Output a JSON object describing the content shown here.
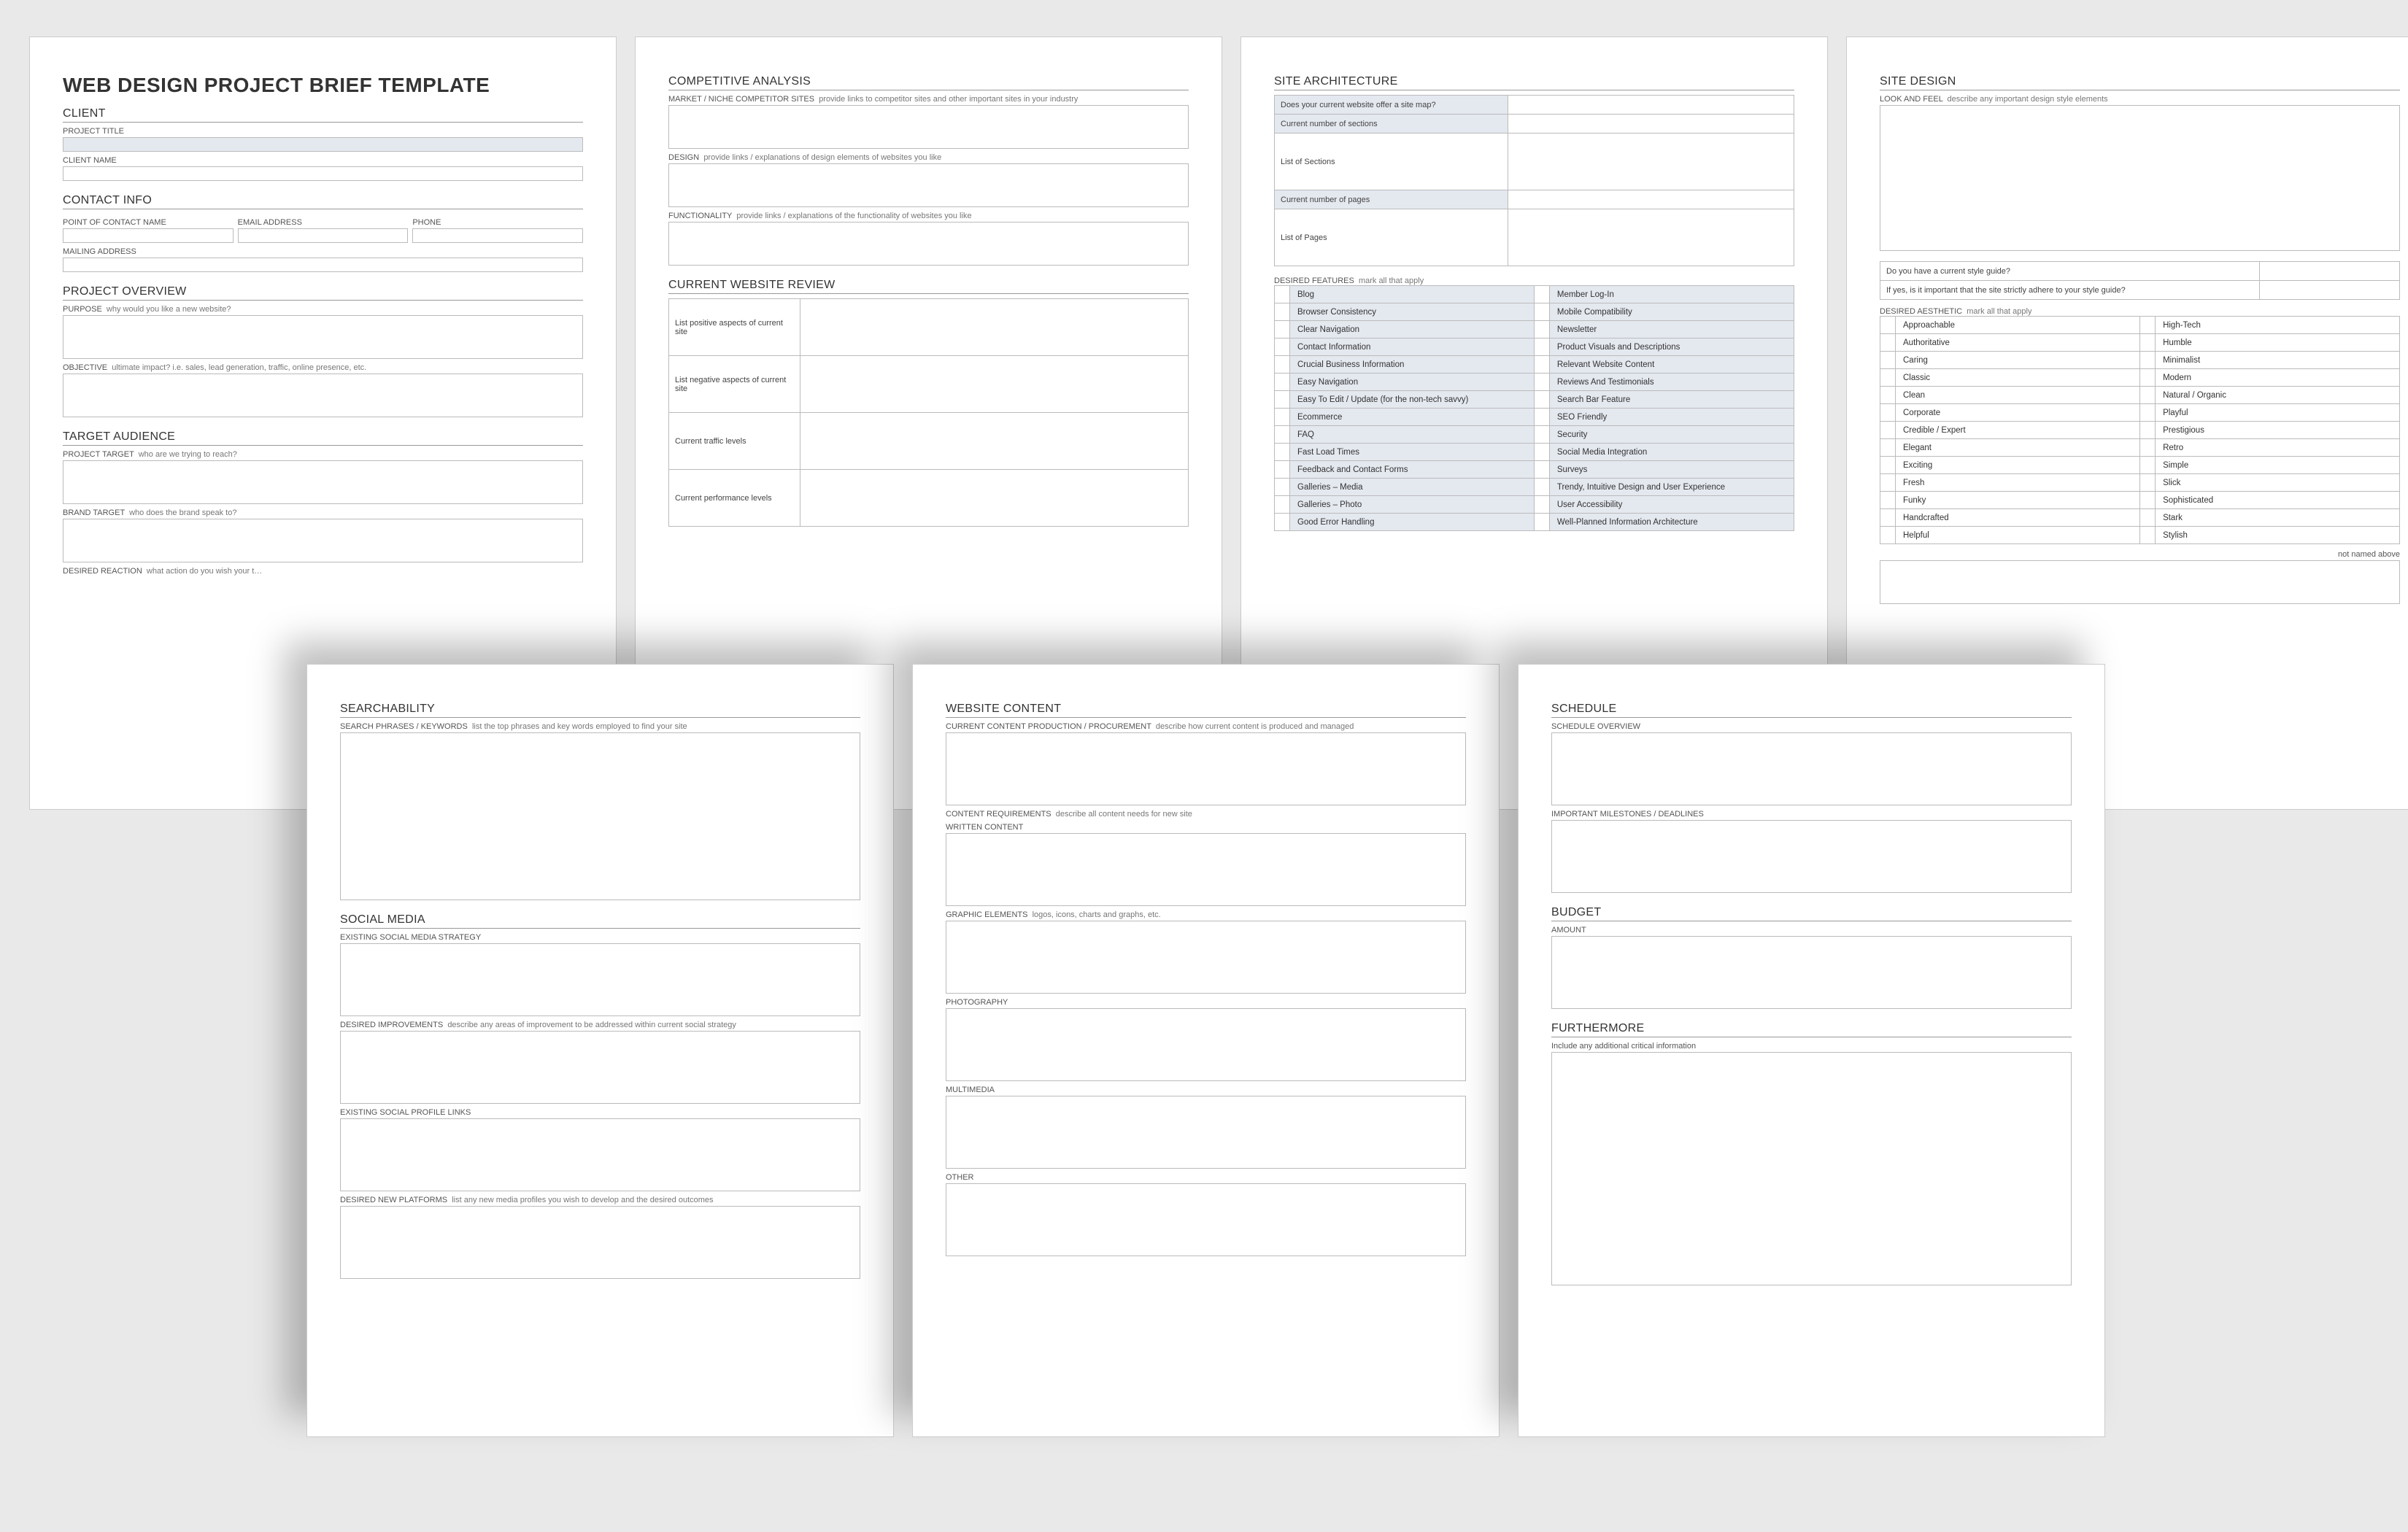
{
  "doc_title": "WEB DESIGN PROJECT BRIEF TEMPLATE",
  "p1": {
    "sec_client": "CLIENT",
    "project_title": "PROJECT TITLE",
    "client_name": "CLIENT NAME",
    "sec_contact": "CONTACT INFO",
    "poc": "POINT OF CONTACT NAME",
    "email": "EMAIL ADDRESS",
    "phone": "PHONE",
    "mailing": "MAILING ADDRESS",
    "sec_overview": "PROJECT OVERVIEW",
    "purpose_lbl": "PURPOSE",
    "purpose_hint": "why would you like a new website?",
    "objective_lbl": "OBJECTIVE",
    "objective_hint": "ultimate impact? i.e. sales, lead generation, traffic, online presence, etc.",
    "sec_target": "TARGET AUDIENCE",
    "proj_target_lbl": "PROJECT TARGET",
    "proj_target_hint": "who are we trying to reach?",
    "brand_target_lbl": "BRAND TARGET",
    "brand_target_hint": "who does the brand speak to?",
    "desired_reaction_lbl": "DESIRED REACTION",
    "desired_reaction_hint": "what action do you wish your t…"
  },
  "p2": {
    "sec_comp": "COMPETITIVE ANALYSIS",
    "market_lbl": "MARKET / NICHE COMPETITOR SITES",
    "market_hint": "provide links to competitor sites and other important sites in your industry",
    "design_lbl": "DESIGN",
    "design_hint": "provide links / explanations of design elements of websites you like",
    "func_lbl": "FUNCTIONALITY",
    "func_hint": "provide links / explanations of the functionality of websites you like",
    "sec_review": "CURRENT WEBSITE REVIEW",
    "pos": "List positive aspects of current site",
    "neg": "List negative aspects of current site",
    "traffic": "Current traffic levels",
    "perf": "Current performance levels"
  },
  "p3": {
    "sec_arch": "SITE ARCHITECTURE",
    "sitemap_q": "Does your current website offer a site map?",
    "num_sections": "Current number of sections",
    "list_sections": "List of Sections",
    "num_pages": "Current number of pages",
    "list_pages": "List of Pages",
    "sec_features": "DESIRED FEATURES",
    "features_hint": "mark all that apply",
    "features_left": [
      "Blog",
      "Browser Consistency",
      "Clear Navigation",
      "Contact Information",
      "Crucial Business Information",
      "Easy Navigation",
      "Easy To Edit / Update (for the non-tech savvy)",
      "Ecommerce",
      "FAQ",
      "Fast Load Times",
      "Feedback and Contact Forms",
      "Galleries – Media",
      "Galleries – Photo",
      "Good Error Handling"
    ],
    "features_right": [
      "Member Log-In",
      "Mobile Compatibility",
      "Newsletter",
      "Product Visuals and Descriptions",
      "Relevant Website Content",
      "Reviews And Testimonials",
      "Search Bar Feature",
      "SEO Friendly",
      "Security",
      "Social Media Integration",
      "Surveys",
      "Trendy, Intuitive Design and User Experience",
      "User Accessibility",
      "Well-Planned Information Architecture"
    ]
  },
  "p4": {
    "sec_design": "SITE DESIGN",
    "look_lbl": "LOOK AND FEEL",
    "look_hint": "describe any important design style elements",
    "style_q1": "Do you have a current style guide?",
    "style_q2": "If yes, is it important that the site strictly adhere to your style guide?",
    "sec_aesthetic": "DESIRED AESTHETIC",
    "aesthetic_hint": "mark all that apply",
    "aesth_left": [
      "Approachable",
      "Authoritative",
      "Caring",
      "Classic",
      "Clean",
      "Corporate",
      "Credible / Expert",
      "Elegant",
      "Exciting",
      "Fresh",
      "Funky",
      "Handcrafted",
      "Helpful"
    ],
    "aesth_right": [
      "High-Tech",
      "Humble",
      "Minimalist",
      "Modern",
      "Natural / Organic",
      "Playful",
      "Prestigious",
      "Retro",
      "Simple",
      "Slick",
      "Sophisticated",
      "Stark",
      "Stylish"
    ],
    "not_named": "not named above"
  },
  "p5": {
    "sec_search": "SEARCHABILITY",
    "search_lbl": "SEARCH PHRASES / KEYWORDS",
    "search_hint": "list the top phrases and key words employed to find your site",
    "sec_social": "SOCIAL MEDIA",
    "existing": "EXISTING SOCIAL MEDIA STRATEGY",
    "improve_lbl": "DESIRED IMPROVEMENTS",
    "improve_hint": "describe any areas of improvement to be addressed within current social strategy",
    "links": "EXISTING SOCIAL PROFILE LINKS",
    "newplat_lbl": "DESIRED NEW PLATFORMS",
    "newplat_hint": "list any new media profiles you wish to develop and the desired outcomes"
  },
  "p6": {
    "sec_content": "WEBSITE CONTENT",
    "curr_lbl": "CURRENT CONTENT PRODUCTION / PROCUREMENT",
    "curr_hint": "describe how current content is produced and managed",
    "req_lbl": "CONTENT REQUIREMENTS",
    "req_hint": "describe all content needs for new site",
    "written": "WRITTEN CONTENT",
    "graphic_lbl": "GRAPHIC ELEMENTS",
    "graphic_hint": "logos, icons, charts and graphs, etc.",
    "photo": "PHOTOGRAPHY",
    "multi": "MULTIMEDIA",
    "other": "OTHER"
  },
  "p7": {
    "sec_schedule": "SCHEDULE",
    "overview": "SCHEDULE OVERVIEW",
    "milestones": "IMPORTANT MILESTONES / DEADLINES",
    "sec_budget": "BUDGET",
    "amount": "AMOUNT",
    "sec_more": "FURTHERMORE",
    "more_hint": "Include any additional critical information"
  }
}
